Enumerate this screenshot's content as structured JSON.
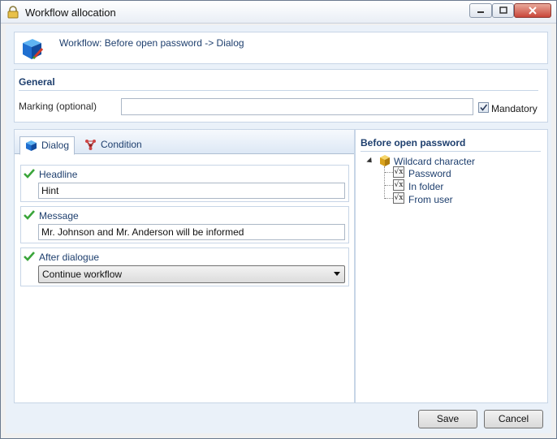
{
  "window": {
    "title": "Workflow allocation"
  },
  "header": {
    "text": "Workflow: Before open password -> Dialog"
  },
  "general": {
    "title": "General",
    "marking_label": "Marking (optional)",
    "marking_value": "",
    "mandatory_label": "Mandatory",
    "mandatory_checked": true
  },
  "tabs": [
    {
      "label": "Dialog",
      "icon": "blue-cube-icon",
      "active": true
    },
    {
      "label": "Condition",
      "icon": "molecule-icon",
      "active": false
    }
  ],
  "dialog": {
    "headline": {
      "label": "Headline",
      "value": "Hint"
    },
    "message": {
      "label": "Message",
      "value": "Mr. Johnson and Mr. Anderson will be informed"
    },
    "after": {
      "label": "After dialogue",
      "selected": "Continue workflow"
    }
  },
  "tree": {
    "title": "Before open password",
    "root": {
      "label": "Wildcard character",
      "icon": "gold-cube-icon",
      "expanded": true
    },
    "items": [
      {
        "label": "Password",
        "icon": "sqrt-icon"
      },
      {
        "label": "In folder",
        "icon": "sqrt-icon"
      },
      {
        "label": "From user",
        "icon": "sqrt-icon"
      }
    ]
  },
  "buttons": {
    "save": "Save",
    "cancel": "Cancel"
  },
  "colors": {
    "accent_text": "#1e3f6e",
    "panel_border": "#c7d5e6",
    "client_bg": "#eaf1f9",
    "check_green": "#3aa53a"
  }
}
